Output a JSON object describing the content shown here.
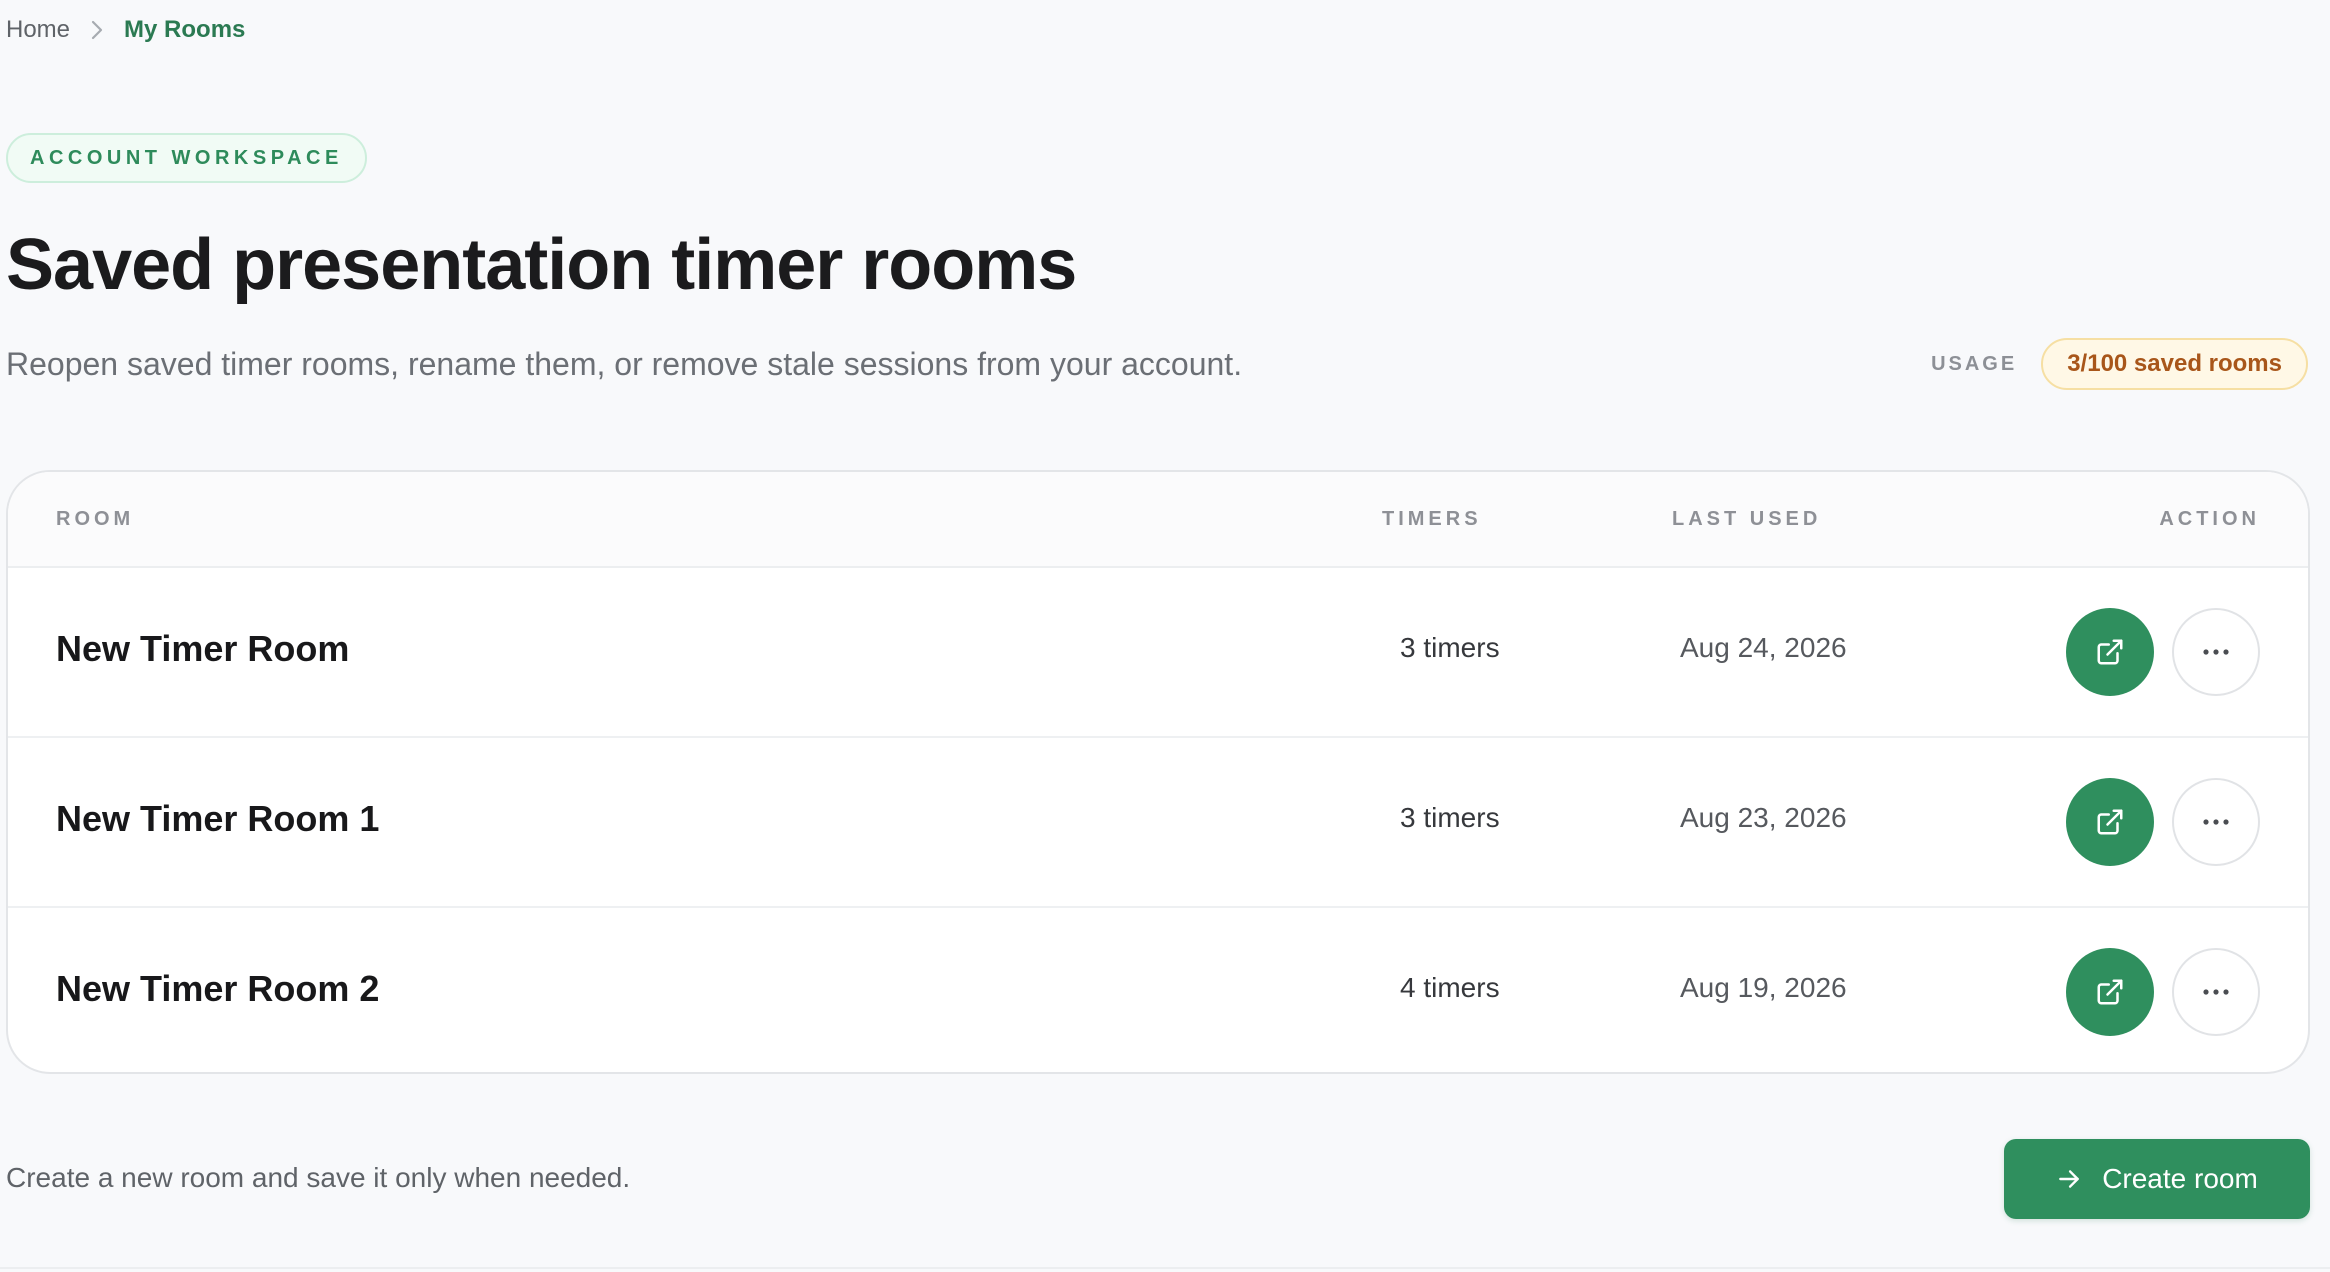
{
  "breadcrumb": {
    "home": "Home",
    "current": "My Rooms"
  },
  "header": {
    "eyebrow": "ACCOUNT WORKSPACE",
    "title": "Saved presentation timer rooms",
    "subtitle": "Reopen saved timer rooms, rename them, or remove stale sessions from your account.",
    "usage_label": "USAGE",
    "usage_value": "3/100 saved rooms"
  },
  "table": {
    "columns": {
      "room": "ROOM",
      "timers": "TIMERS",
      "last_used": "LAST USED",
      "action": "ACTION"
    },
    "rows": [
      {
        "name": "New Timer Room",
        "timers": "3 timers",
        "last_used": "Aug 24, 2026"
      },
      {
        "name": "New Timer Room 1",
        "timers": "3 timers",
        "last_used": "Aug 23, 2026"
      },
      {
        "name": "New Timer Room 2",
        "timers": "4 timers",
        "last_used": "Aug 19, 2026"
      }
    ]
  },
  "footer": {
    "note": "Create a new room and save it only when needed.",
    "create_label": "Create room"
  },
  "icons": {
    "breadcrumb_separator": "chevron-right-icon",
    "open_room": "external-link-icon",
    "more_options": "more-horizontal-icon",
    "create": "arrow-right-icon"
  },
  "colors": {
    "accent": "#2f8f5e",
    "usage_text": "#a8561a",
    "usage_bg": "#fff8e6"
  }
}
